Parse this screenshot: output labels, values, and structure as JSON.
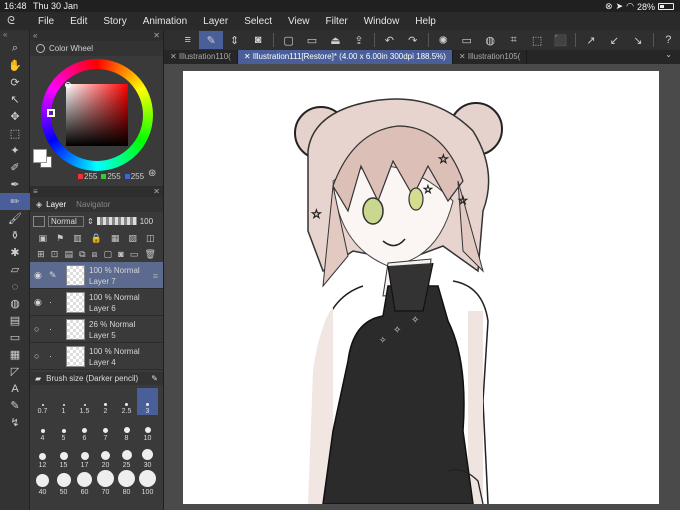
{
  "status": {
    "time": "16:48",
    "date": "Thu 30 Jan",
    "battery": "28%"
  },
  "menu": [
    "File",
    "Edit",
    "Story",
    "Animation",
    "Layer",
    "Select",
    "View",
    "Filter",
    "Window",
    "Help"
  ],
  "tools": [
    {
      "name": "zoom-icon",
      "glyph": "⌕"
    },
    {
      "name": "hand-icon",
      "glyph": "✋"
    },
    {
      "name": "rotate-icon",
      "glyph": "⟳"
    },
    {
      "name": "operation-icon",
      "glyph": "↖"
    },
    {
      "name": "move-layer-icon",
      "glyph": "✥"
    },
    {
      "name": "selection-icon",
      "glyph": "⬚"
    },
    {
      "name": "magic-wand-icon",
      "glyph": "✦"
    },
    {
      "name": "eyedropper-icon",
      "glyph": "✐"
    },
    {
      "name": "pen-icon",
      "glyph": "✒"
    },
    {
      "name": "pencil-icon",
      "glyph": "✏"
    },
    {
      "name": "brush-icon",
      "glyph": "🖌"
    },
    {
      "name": "airbrush-icon",
      "glyph": "⚱"
    },
    {
      "name": "decoration-icon",
      "glyph": "✱"
    },
    {
      "name": "eraser-icon",
      "glyph": "▱"
    },
    {
      "name": "blend-icon",
      "glyph": "◌"
    },
    {
      "name": "fill-icon",
      "glyph": "◍"
    },
    {
      "name": "gradient-icon",
      "glyph": "▤"
    },
    {
      "name": "figure-icon",
      "glyph": "▭"
    },
    {
      "name": "frame-icon",
      "glyph": "▦"
    },
    {
      "name": "ruler-icon",
      "glyph": "◸"
    },
    {
      "name": "text-icon",
      "glyph": "A"
    },
    {
      "name": "balloon-icon",
      "glyph": "✎"
    },
    {
      "name": "correct-line-icon",
      "glyph": "↯"
    }
  ],
  "color_wheel": {
    "title": "Color Wheel",
    "r": "255",
    "g": "255",
    "b": "255",
    "current_color": "#ffffff"
  },
  "layer_panel": {
    "tab_layer": "Layer",
    "tab_navigator": "Navigator",
    "blend_mode": "Normal",
    "opacity": "100",
    "layers": [
      {
        "opacity_blend": "100 % Normal",
        "name": "Layer 7",
        "selected": true,
        "visible": true
      },
      {
        "opacity_blend": "100 % Normal",
        "name": "Layer 6",
        "selected": false,
        "visible": true
      },
      {
        "opacity_blend": "26 % Normal",
        "name": "Layer 5",
        "selected": false,
        "visible": false
      },
      {
        "opacity_blend": "100 % Normal",
        "name": "Layer 4",
        "selected": false,
        "visible": false
      }
    ]
  },
  "brush_size": {
    "title": "Brush size (Darker pencil)",
    "sizes": [
      "0.7",
      "1",
      "1.5",
      "2",
      "2.5",
      "3",
      "4",
      "5",
      "6",
      "7",
      "8",
      "10",
      "12",
      "15",
      "17",
      "20",
      "25",
      "30",
      "40",
      "50",
      "60",
      "70",
      "80",
      "100"
    ],
    "selected": "3"
  },
  "tabs": [
    {
      "label": "Illustration110(",
      "active": false
    },
    {
      "label": "Illustration111[Restore]* (4.00 x 6.00in 300dpi 188.5%)",
      "active": true
    },
    {
      "label": "Illustration105(",
      "active": false
    }
  ],
  "accent": "#4a5f9a"
}
